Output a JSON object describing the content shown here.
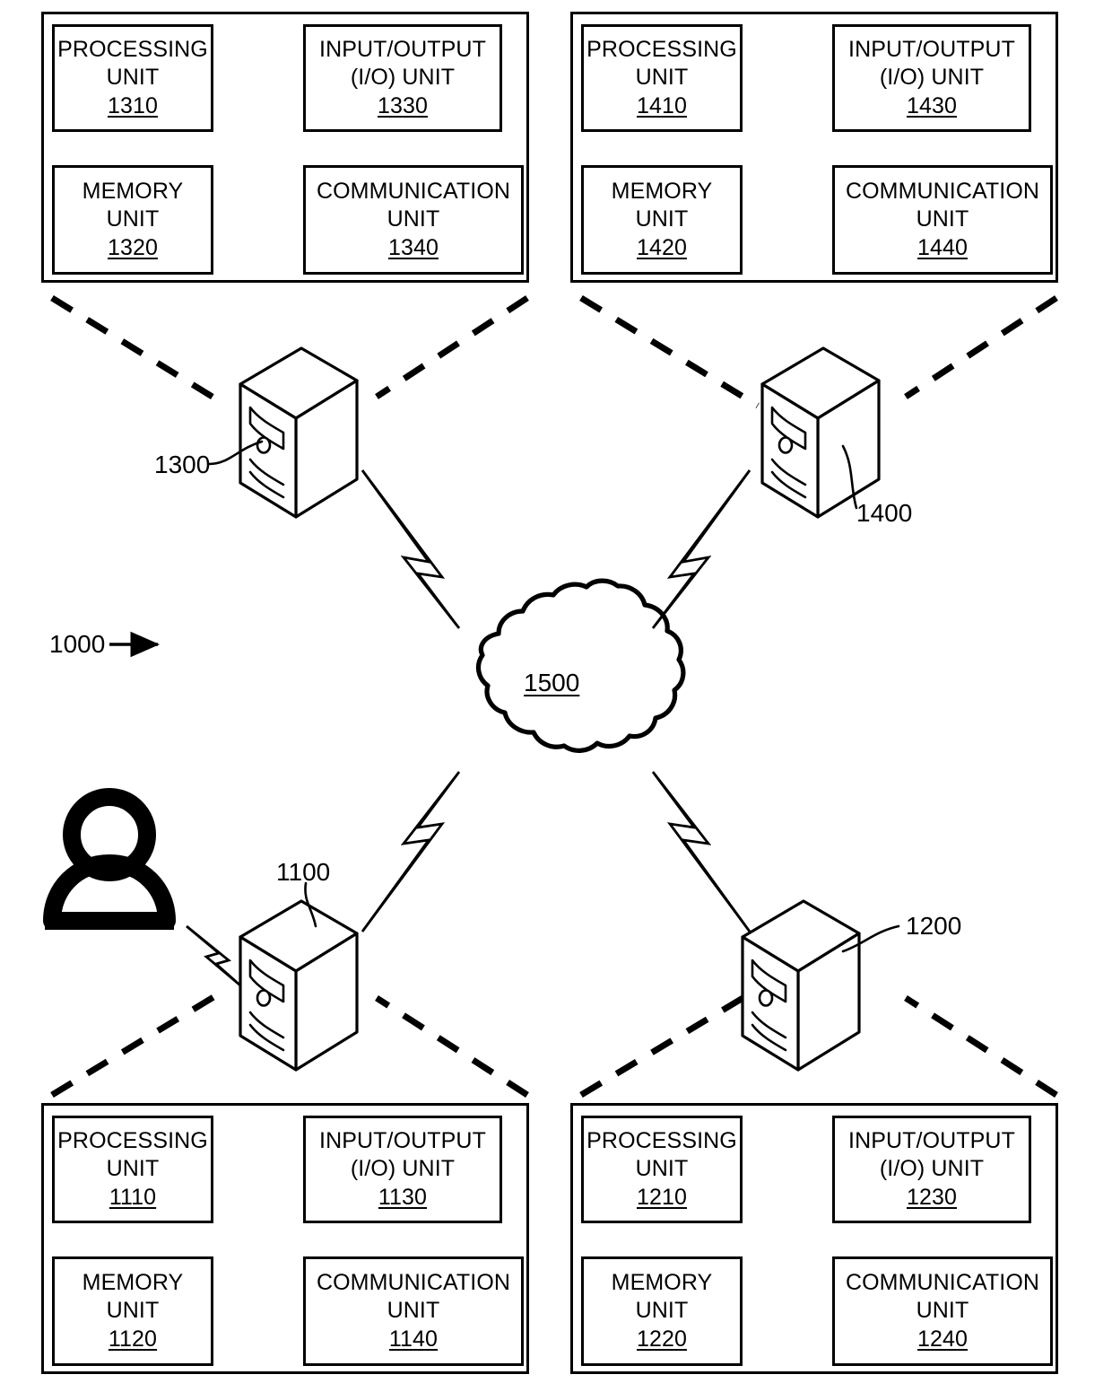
{
  "figure": {
    "system_ref": "1000",
    "network_cloud_ref": "1500",
    "unit_labels": {
      "processing_l1": "PROCESSING",
      "processing_l2": "UNIT",
      "io_l1": "INPUT/OUTPUT",
      "io_l2": "(I/O) UNIT",
      "memory_l1": "MEMORY",
      "memory_l2": "UNIT",
      "communication_l1": "COMMUNICATION",
      "communication_l2": "UNIT"
    },
    "devices": [
      {
        "id": "device-1300",
        "server_ref": "1300",
        "panel_position": "top-left",
        "units": {
          "processing_ref": "1310",
          "memory_ref": "1320",
          "io_ref": "1330",
          "communication_ref": "1340"
        }
      },
      {
        "id": "device-1400",
        "server_ref": "1400",
        "panel_position": "top-right",
        "units": {
          "processing_ref": "1410",
          "memory_ref": "1420",
          "io_ref": "1430",
          "communication_ref": "1440"
        }
      },
      {
        "id": "device-1100",
        "server_ref": "1100",
        "panel_position": "bottom-left",
        "units": {
          "processing_ref": "1110",
          "memory_ref": "1120",
          "io_ref": "1130",
          "communication_ref": "1140"
        }
      },
      {
        "id": "device-1200",
        "server_ref": "1200",
        "panel_position": "bottom-right",
        "units": {
          "processing_ref": "1210",
          "memory_ref": "1220",
          "io_ref": "1230",
          "communication_ref": "1240"
        }
      }
    ],
    "colors": {
      "line": "#000000",
      "background": "#ffffff"
    }
  }
}
